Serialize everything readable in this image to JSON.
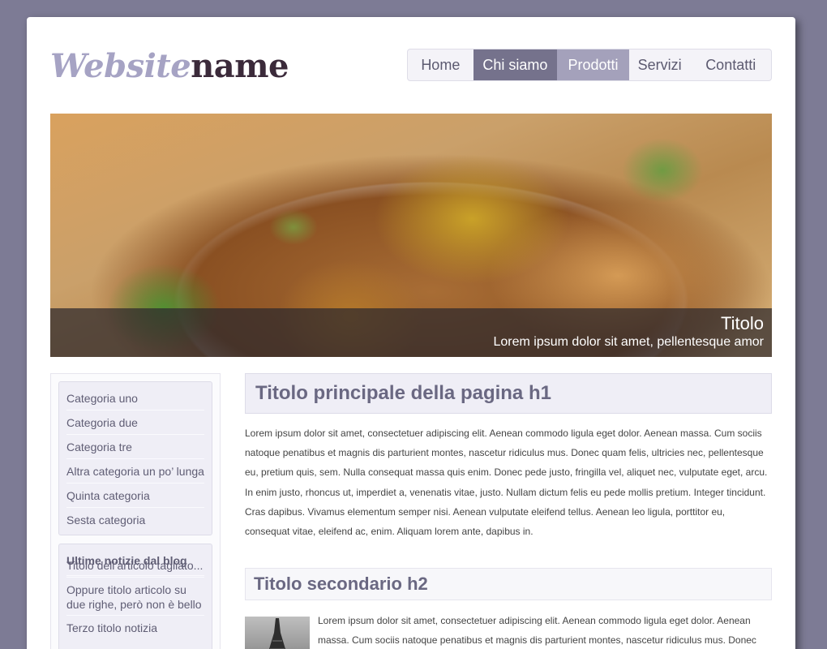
{
  "logo": {
    "part1": "Website",
    "part2": "name"
  },
  "nav": {
    "items": [
      "Home",
      "Chi siamo",
      "Prodotti",
      "Servizi",
      "Contatti"
    ]
  },
  "hero": {
    "title": "Titolo",
    "subtitle": "Lorem ipsum dolor sit amet, pellentesque amor"
  },
  "sidebar": {
    "categories": [
      "Categoria uno",
      "Categoria due",
      "Categoria tre",
      "Altra categoria un po’ lunga",
      "Quinta categoria",
      "Sesta categoria"
    ],
    "blog": {
      "heading": "Ultime notizie dal blog",
      "posts": [
        "Titolo dell’articolo tagliato...",
        "Oppure titolo articolo su due righe, però non è bello",
        "Terzo titolo notizia"
      ]
    }
  },
  "main": {
    "h1": "Titolo principale della pagina h1",
    "paragraph": "Lorem ipsum dolor sit amet, consectetuer adipiscing elit. Aenean commodo ligula eget dolor. Aenean massa. Cum sociis natoque penatibus et magnis dis parturient montes, nascetur ridiculus mus. Donec quam felis, ultricies nec, pellentesque eu, pretium quis, sem. Nulla consequat massa quis enim. Donec pede justo, fringilla vel, aliquet nec, vulputate eget, arcu. In enim justo, rhoncus ut, imperdiet a, venenatis vitae, justo. Nullam dictum felis eu pede mollis pretium. Integer tincidunt. Cras dapibus. Vivamus elementum semper nisi. Aenean vulputate eleifend tellus. Aenean leo ligula, porttitor eu, consequat vitae, eleifend ac, enim. Aliquam lorem ante, dapibus in.",
    "h2": "Titolo secondario h2",
    "paragraph2": "Lorem ipsum dolor sit amet, consectetuer adipiscing elit. Aenean commodo ligula eget dolor. Aenean massa. Cum sociis natoque penatibus et magnis dis parturient montes, nascetur ridiculus mus. Donec"
  },
  "colors": {
    "accent": "#75728c",
    "accent_light": "#a4a1bb",
    "logo_light": "#a6a3c4",
    "logo_dark": "#3b2a3a",
    "background": "#7d7b95"
  }
}
